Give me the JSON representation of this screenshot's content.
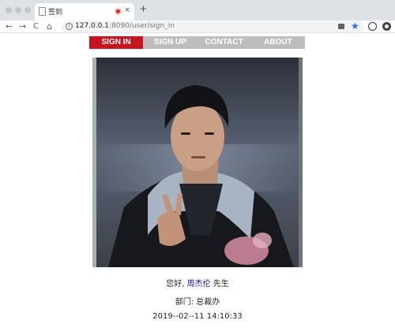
{
  "browser": {
    "tab_title": "签到",
    "new_tab_symbol": "+",
    "close_symbol": "×",
    "url_host": "127.0.0.1",
    "url_path": ":8090/user/sign_in",
    "info_symbol": "i",
    "back_symbol": "←",
    "forward_symbol": "→",
    "reload_symbol": "C",
    "home_symbol": "⌂",
    "star_symbol": "★"
  },
  "nav": {
    "items": [
      {
        "label": "SIGN IN",
        "active": true
      },
      {
        "label": "SIGN UP",
        "active": false
      },
      {
        "label": "CONTACT",
        "active": false
      },
      {
        "label": "ABOUT",
        "active": false
      }
    ]
  },
  "profile": {
    "photo_icon": "user-portrait-photo",
    "greeting_prefix": "您好,",
    "name": "周杰伦",
    "greeting_suffix": "先生",
    "dept_label": "部门:",
    "dept_value": "总裁办",
    "timestamp": "2019--02--11 14:10:33"
  },
  "colors": {
    "nav_active": "#c8151d",
    "nav_background": "#bdbdbd",
    "link": "#1a0dab"
  }
}
